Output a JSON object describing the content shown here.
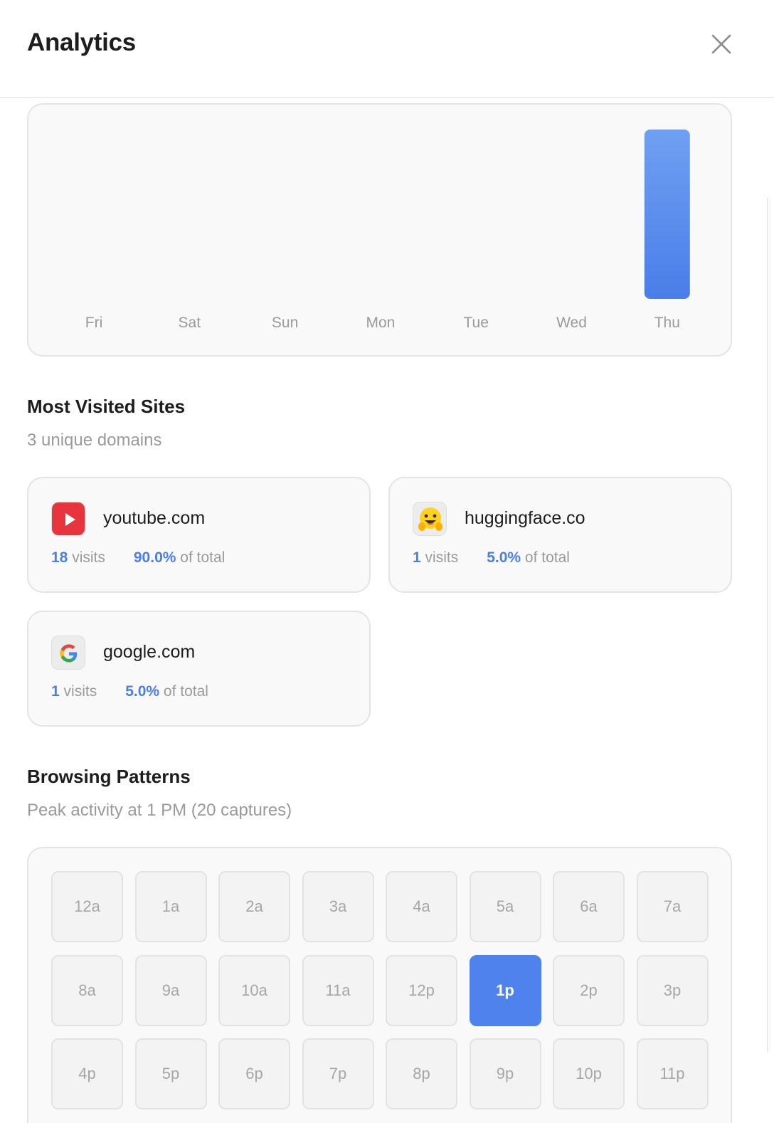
{
  "header": {
    "title": "Analytics"
  },
  "chart_data": {
    "type": "bar",
    "categories": [
      "Fri",
      "Sat",
      "Sun",
      "Mon",
      "Tue",
      "Wed",
      "Thu"
    ],
    "values": [
      0,
      0,
      0,
      0,
      0,
      0,
      20
    ],
    "bar_color": "#4f82ec"
  },
  "most_visited": {
    "title": "Most Visited Sites",
    "subtitle": "3 unique domains",
    "sites": [
      {
        "domain": "youtube.com",
        "icon": "youtube-icon",
        "visits": "18",
        "visits_label": "visits",
        "percent": "90.0%",
        "percent_label": "of total"
      },
      {
        "domain": "huggingface.co",
        "icon": "huggingface-icon",
        "visits": "1",
        "visits_label": "visits",
        "percent": "5.0%",
        "percent_label": "of total"
      },
      {
        "domain": "google.com",
        "icon": "google-icon",
        "visits": "1",
        "visits_label": "visits",
        "percent": "5.0%",
        "percent_label": "of total"
      }
    ]
  },
  "browsing_patterns": {
    "title": "Browsing Patterns",
    "subtitle": "Peak activity at 1 PM (20 captures)",
    "hours": [
      "12a",
      "1a",
      "2a",
      "3a",
      "4a",
      "5a",
      "6a",
      "7a",
      "8a",
      "9a",
      "10a",
      "11a",
      "12p",
      "1p",
      "2p",
      "3p",
      "4p",
      "5p",
      "6p",
      "7p",
      "8p",
      "9p",
      "10p",
      "11p"
    ],
    "peak_hour": "1p",
    "accent": "#4f82ec"
  }
}
